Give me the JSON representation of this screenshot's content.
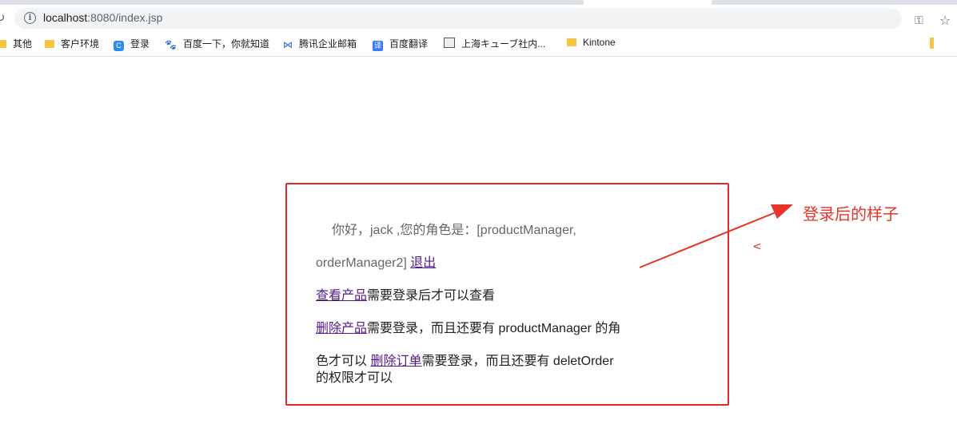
{
  "browser": {
    "url_host": "localhost",
    "url_rest": ":8080/index.jsp",
    "bookmarks": [
      {
        "label": "其他",
        "icon": "folder-icon"
      },
      {
        "label": "客户环境",
        "icon": "folder-icon"
      },
      {
        "label": "登录",
        "icon": "c-logo-icon"
      },
      {
        "label": "百度一下，你就知道",
        "icon": "baidu-paw-icon"
      },
      {
        "label": "腾讯企业邮箱",
        "icon": "tencent-icon"
      },
      {
        "label": "百度翻译",
        "icon": "translate-icon"
      },
      {
        "label": "上海キューブ社内...",
        "icon": "image-icon"
      },
      {
        "label": "Kintone",
        "icon": "folder-icon"
      }
    ]
  },
  "page": {
    "greeting_line1": "你好，jack ,您的角色是：[productManager,",
    "greeting_line2": "orderManager2]",
    "logout_link": "退出",
    "view_product_link": "查看产品",
    "view_product_text": "需要登录后才可以查看",
    "delete_product_link": "删除产品",
    "delete_product_text": "需要登录，而且还要有 productManager 的角",
    "delete_product_text2": "色才可以",
    "delete_order_link": "删除订单",
    "delete_order_text": "需要登录，而且还要有 deletOrder",
    "delete_order_text2": "的权限才可以"
  },
  "annotation": {
    "label": "登录后的样子",
    "mark": "<",
    "color": "#e8332a"
  }
}
